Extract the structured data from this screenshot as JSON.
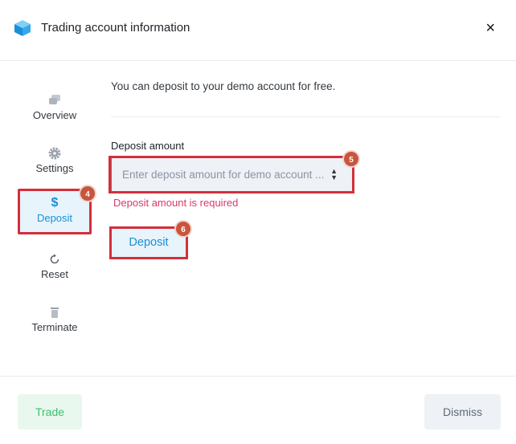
{
  "header": {
    "title": "Trading account information",
    "close_symbol": "×"
  },
  "sidebar": {
    "items": [
      {
        "label": "Overview",
        "icon": "chat-bubbles-icon"
      },
      {
        "label": "Settings",
        "icon": "gear-icon"
      },
      {
        "label": "Deposit",
        "icon": "dollar-icon",
        "symbol": "$"
      },
      {
        "label": "Reset",
        "icon": "reset-icon"
      },
      {
        "label": "Terminate",
        "icon": "trash-icon"
      }
    ]
  },
  "main": {
    "intro": "You can deposit to your demo account for free.",
    "field_label": "Deposit amount",
    "input_placeholder": "Enter deposit amount for demo account ...",
    "input_value": "",
    "error": "Deposit amount is required",
    "deposit_button": "Deposit"
  },
  "badges": [
    "4",
    "5",
    "6"
  ],
  "footer": {
    "trade_button": "Trade",
    "dismiss_button": "Dismiss"
  },
  "colors": {
    "accent": "#1a8fd8",
    "highlight": "#d32f3c",
    "error": "#d63b67",
    "trade": "#3fbf6f"
  }
}
